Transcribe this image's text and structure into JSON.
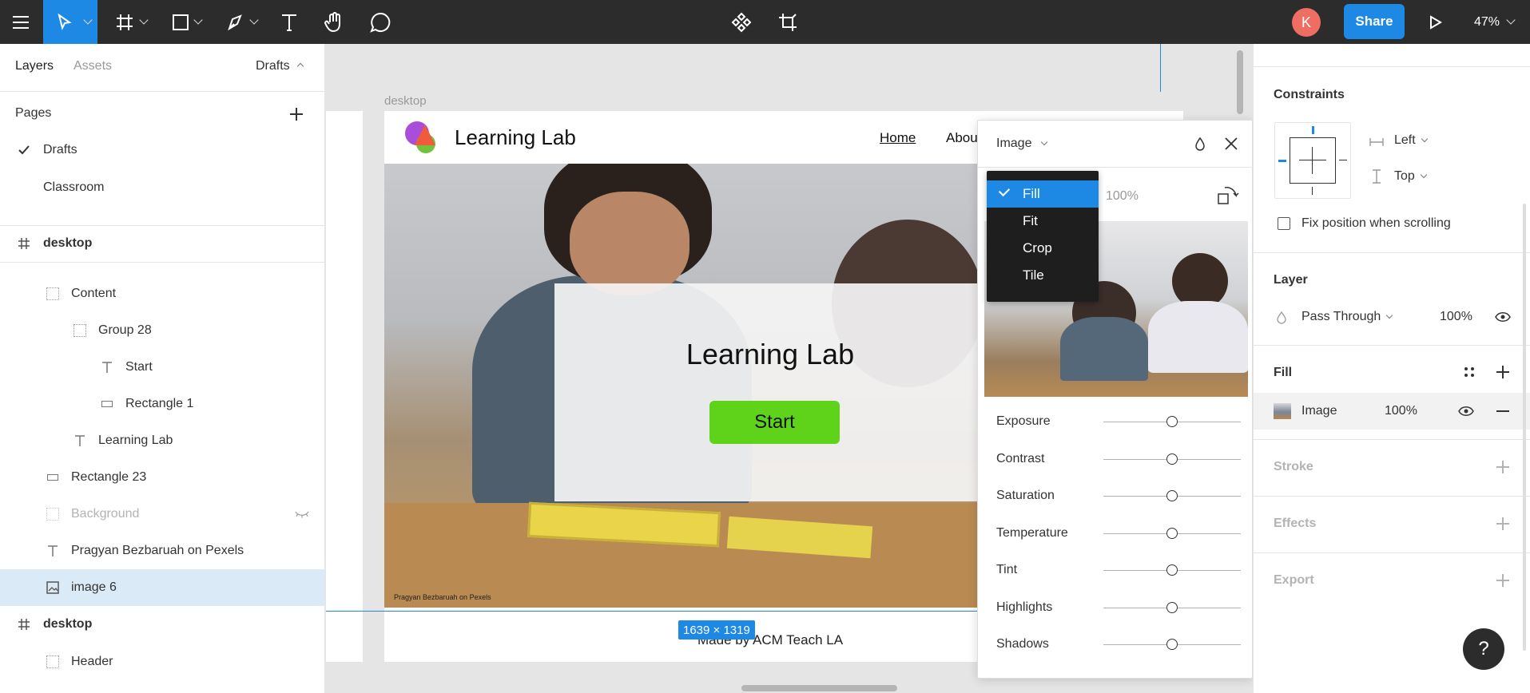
{
  "toolbar": {
    "share_label": "Share",
    "avatar_initial": "K",
    "zoom": "47%"
  },
  "left_panel": {
    "tab_layers": "Layers",
    "tab_assets": "Assets",
    "page_selector": "Drafts",
    "pages_heading": "Pages",
    "pages": [
      "Drafts",
      "Classroom"
    ],
    "layers": [
      {
        "label": "desktop"
      },
      {
        "label": "Content"
      },
      {
        "label": "Group 28"
      },
      {
        "label": "Start"
      },
      {
        "label": "Rectangle 1"
      },
      {
        "label": "Learning Lab"
      },
      {
        "label": "Rectangle 23"
      },
      {
        "label": "Background"
      },
      {
        "label": "Pragyan Bezbaruah on Pexels"
      },
      {
        "label": "image 6"
      },
      {
        "label": "desktop"
      },
      {
        "label": "Header"
      }
    ]
  },
  "canvas": {
    "frame_label": "desktop",
    "site_title": "Learning Lab",
    "nav_home": "Home",
    "nav_about": "Abou",
    "hero_title": "Learning Lab",
    "start_button": "Start",
    "photo_caption": "Pragyan Bezbaruah on Pexels",
    "footer_text": "Made by ACM Teach LA",
    "selection_size": "1639 × 1319"
  },
  "image_popover": {
    "title": "Image",
    "opacity": "100%",
    "sliders": [
      "Exposure",
      "Contrast",
      "Saturation",
      "Temperature",
      "Tint",
      "Highlights",
      "Shadows"
    ],
    "slider_values": [
      0.5,
      0.5,
      0.5,
      0.5,
      0.5,
      0.5,
      0.5
    ]
  },
  "scale_dropdown": {
    "options": [
      "Fill",
      "Fit",
      "Crop",
      "Tile"
    ],
    "selected": "Fill"
  },
  "right_panel": {
    "constraints_heading": "Constraints",
    "horizontal_constraint": "Left",
    "vertical_constraint": "Top",
    "fix_position_label": "Fix position when scrolling",
    "layer_heading": "Layer",
    "blend_mode": "Pass Through",
    "layer_opacity": "100%",
    "fill_heading": "Fill",
    "fill_type": "Image",
    "fill_opacity": "100%",
    "stroke_heading": "Stroke",
    "effects_heading": "Effects",
    "export_heading": "Export"
  },
  "colors": {
    "accent": "#1e88e5",
    "toolbar_bg": "#2c2c2c",
    "start_button": "#5ed31a",
    "avatar": "#ef6e63"
  }
}
